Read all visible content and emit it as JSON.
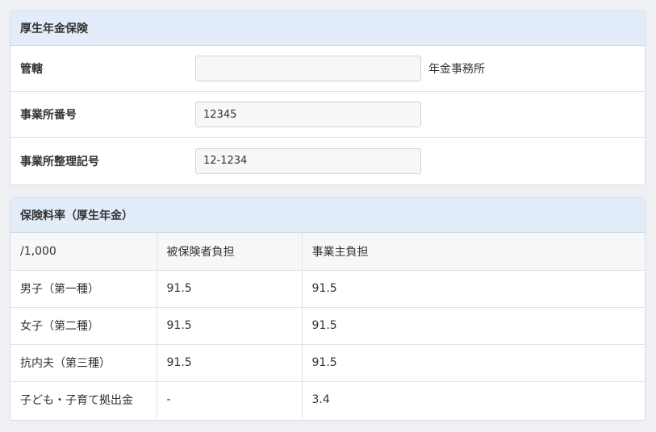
{
  "pension": {
    "heading": "厚生年金保険",
    "fields": [
      {
        "label": "管轄",
        "value": "",
        "suffix": "年金事務所"
      },
      {
        "label": "事業所番号",
        "value": "12345"
      },
      {
        "label": "事業所整理記号",
        "value": "12-1234"
      }
    ]
  },
  "rates": {
    "heading": "保険料率（厚生年金）",
    "columns": [
      "/1,000",
      "被保険者負担",
      "事業主負担"
    ],
    "rows": [
      {
        "label": "男子（第一種）",
        "insured": "91.5",
        "employer": "91.5"
      },
      {
        "label": "女子（第二種）",
        "insured": "91.5",
        "employer": "91.5"
      },
      {
        "label": "抗内夫（第三種）",
        "insured": "91.5",
        "employer": "91.5"
      },
      {
        "label": "子ども・子育て拠出金",
        "insured": "-",
        "employer": "3.4"
      }
    ]
  },
  "colors": {
    "page_bg": "#eef0f4",
    "panel_heading_bg": "#e3edf9",
    "input_bg": "#f7f7f7",
    "border": "#dfe3e8"
  }
}
